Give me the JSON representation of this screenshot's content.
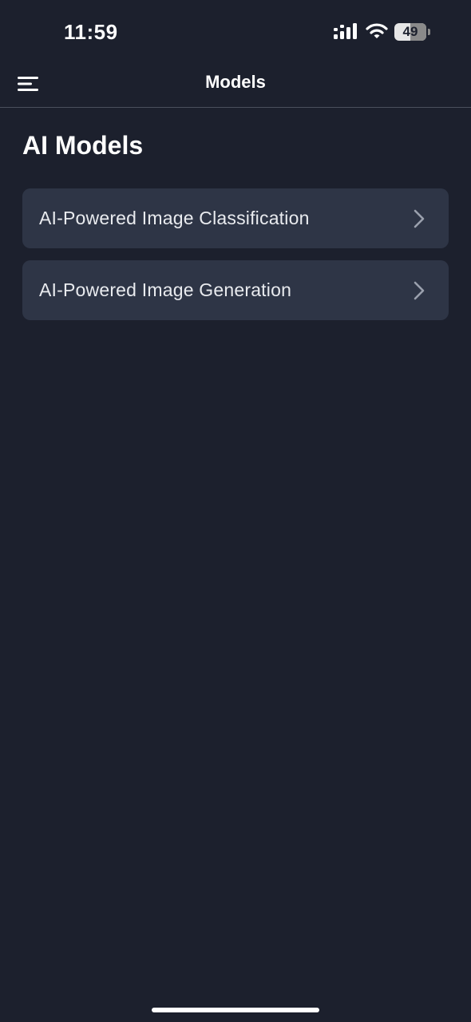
{
  "status_bar": {
    "time": "11:59",
    "battery_level": "49",
    "battery_percent": 49,
    "icons": [
      "signal-icon",
      "wifi-icon",
      "battery-icon"
    ]
  },
  "nav": {
    "title": "Models",
    "menu_icon": "menu-icon"
  },
  "page": {
    "title": "AI Models"
  },
  "models": [
    {
      "label": "AI-Powered Image Classification",
      "icon": "chevron-right-icon"
    },
    {
      "label": "AI-Powered Image Generation",
      "icon": "chevron-right-icon"
    }
  ],
  "colors": {
    "background": "#1c202d",
    "card": "#2e3546",
    "text": "#ffffff",
    "chevron": "#9aa0ad",
    "divider": "#4a4f5c"
  }
}
